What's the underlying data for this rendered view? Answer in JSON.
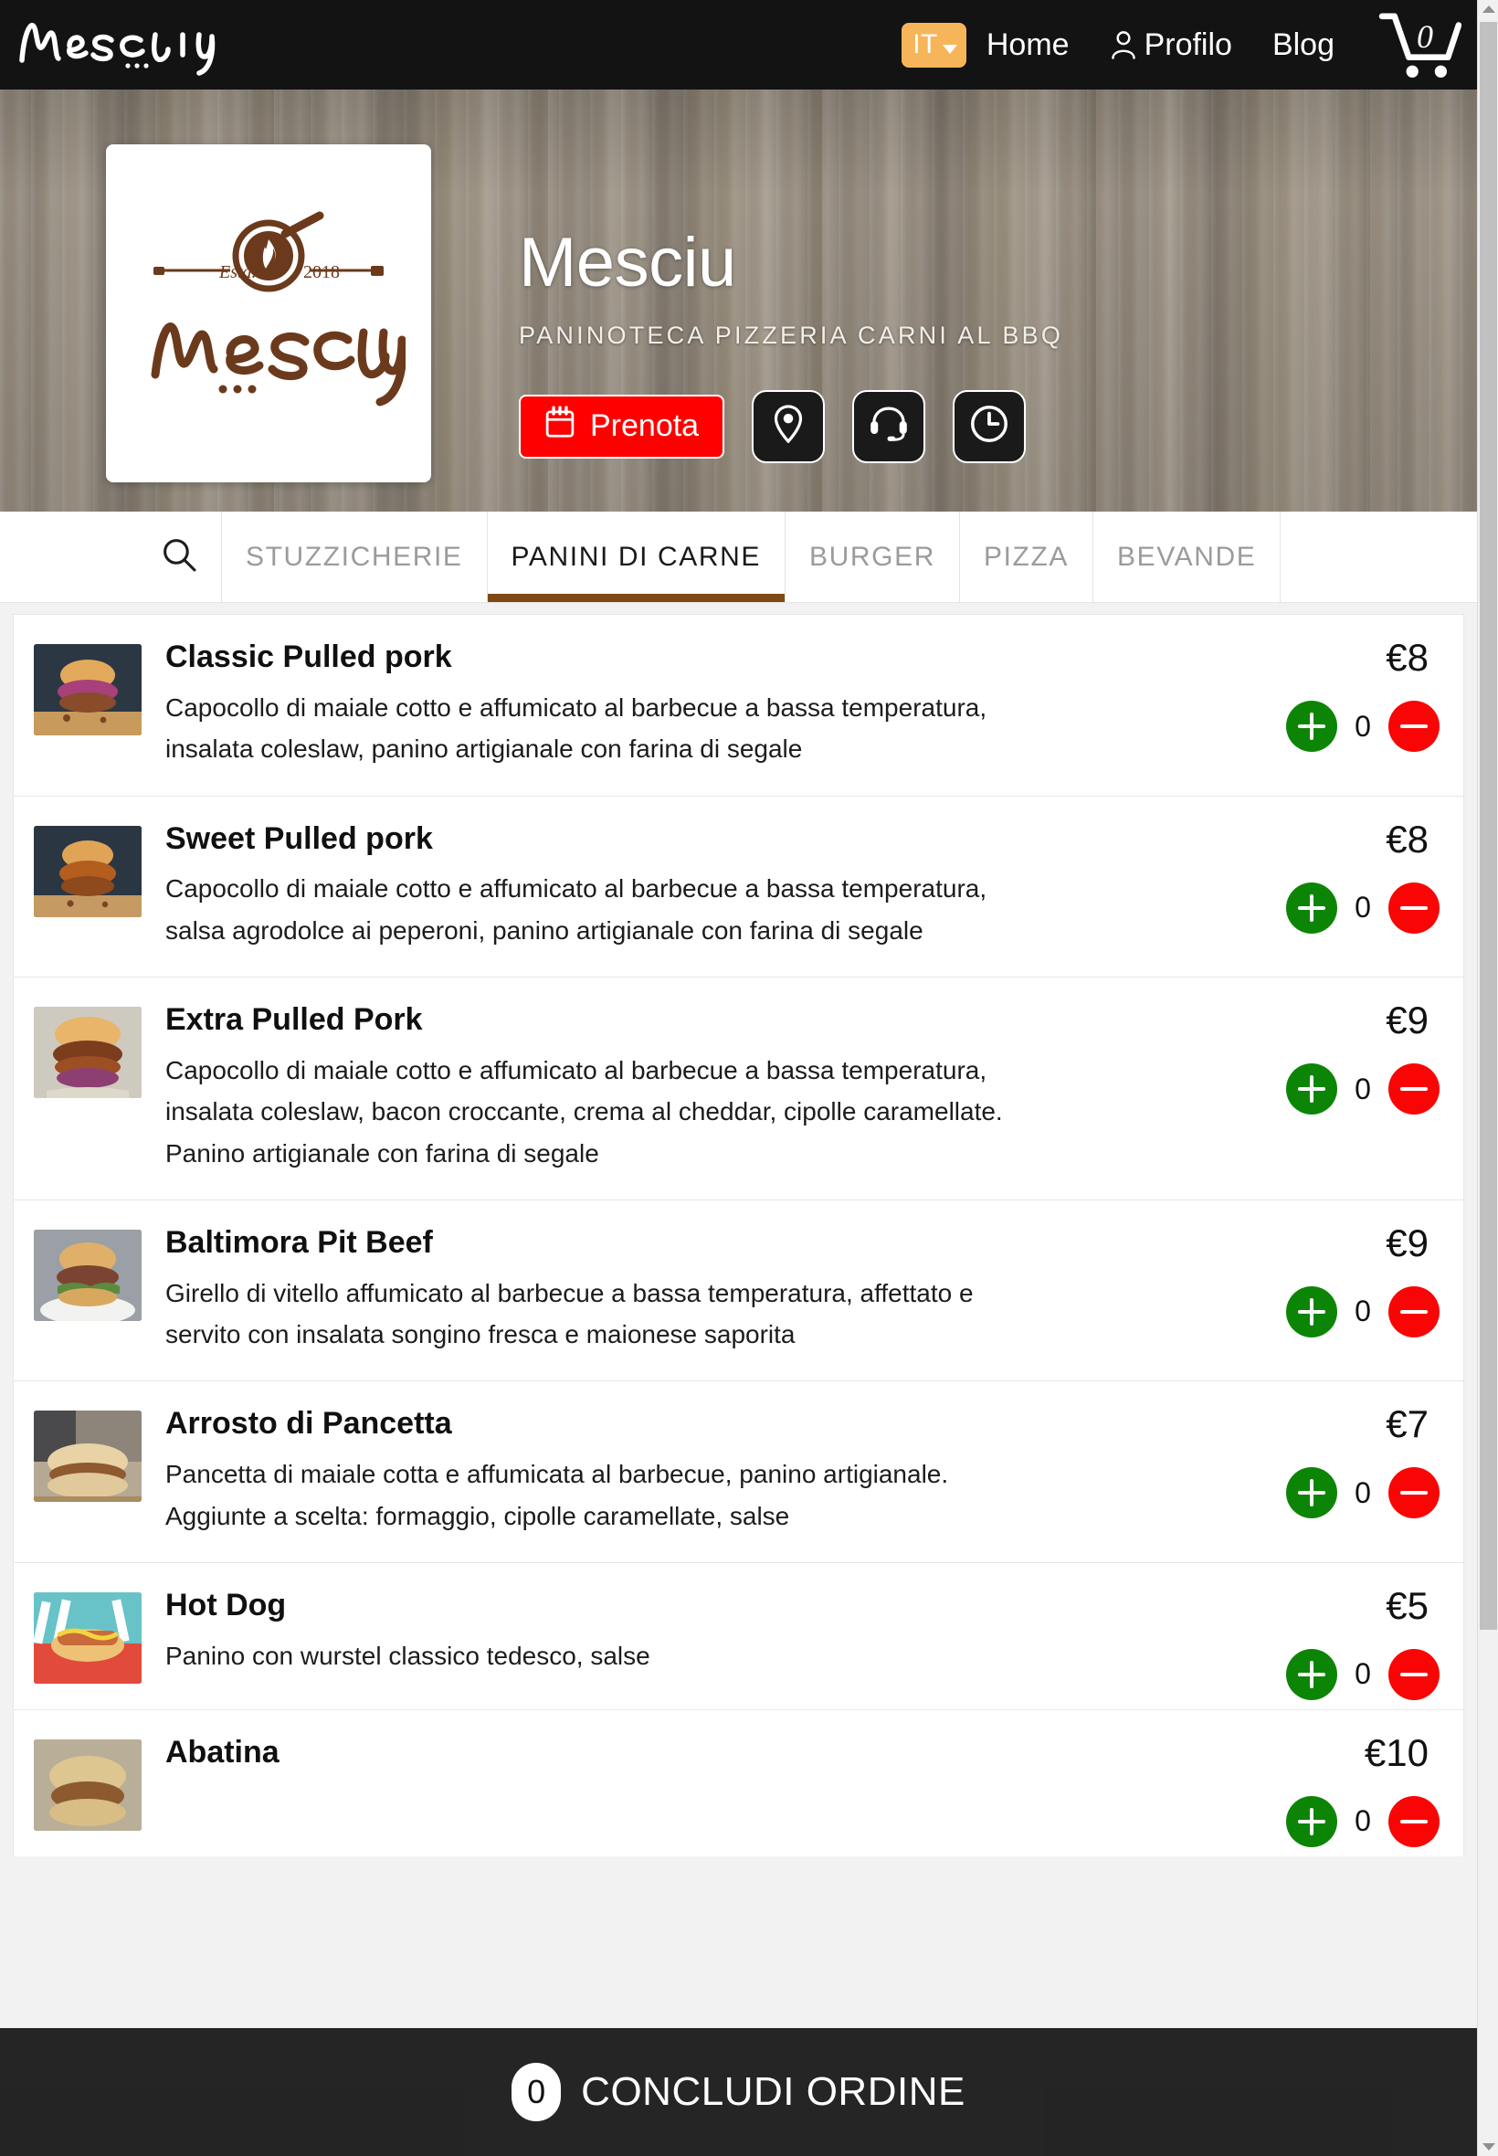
{
  "topnav": {
    "brand": "Mesciu",
    "lang": "IT",
    "links": [
      {
        "label": "Home",
        "icon": ""
      },
      {
        "label": "Profilo",
        "icon": "user-icon"
      },
      {
        "label": "Blog",
        "icon": ""
      }
    ],
    "cart_count": "0"
  },
  "hero": {
    "title": "Mesciu",
    "subtitle": "PANINOTECA PIZZERIA CARNI AL BBQ",
    "logo_text": "Mesciu",
    "logo_estd": "Estd.",
    "logo_year": "2018",
    "actions": {
      "prenota_label": "Prenota",
      "prenota_icon": "calendar-icon",
      "location_icon": "map-pin-icon",
      "support_icon": "headset-icon",
      "hours_icon": "clock-icon"
    }
  },
  "tabs": {
    "search_icon": "search-icon",
    "items": [
      {
        "label": "STUZZICHERIE",
        "active": false
      },
      {
        "label": "PANINI DI CARNE",
        "active": true
      },
      {
        "label": "BURGER",
        "active": false
      },
      {
        "label": "PIZZA",
        "active": false
      },
      {
        "label": "BEVANDE",
        "active": false
      }
    ]
  },
  "menu": {
    "items": [
      {
        "name": "Classic Pulled pork",
        "desc": "Capocollo di maiale cotto e affumicato al barbecue a bassa temperatura, insalata coleslaw, panino artigianale con farina di segale",
        "price": "€8",
        "qty": "0",
        "thumb": "pulled-pork-sandwich"
      },
      {
        "name": "Sweet Pulled pork",
        "desc": "Capocollo di maiale cotto e affumicato al barbecue a bassa temperatura, salsa agrodolce ai peperoni, panino artigianale con farina di segale",
        "price": "€8",
        "qty": "0",
        "thumb": "sweet-pulled-pork-sandwich"
      },
      {
        "name": "Extra Pulled Pork",
        "desc": "Capocollo di maiale cotto e affumicato al barbecue a bassa temperatura, insalata coleslaw, bacon croccante, crema al cheddar, cipolle caramellate. Panino artigianale con farina di segale",
        "price": "€9",
        "qty": "0",
        "thumb": "extra-pulled-pork-sandwich"
      },
      {
        "name": "Baltimora Pit Beef",
        "desc": "Girello di vitello affumicato al barbecue a bassa temperatura, affettato e servito con insalata songino fresca e maionese saporita",
        "price": "€9",
        "qty": "0",
        "thumb": "pit-beef-sandwich"
      },
      {
        "name": "Arrosto di Pancetta",
        "desc": "Pancetta di maiale cotta e affumicata al barbecue, panino artigianale. Aggiunte a scelta: formaggio, cipolle caramellate, salse",
        "price": "€7",
        "qty": "0",
        "thumb": "pancetta-sandwich"
      },
      {
        "name": "Hot Dog",
        "desc": "Panino con wurstel classico tedesco, salse",
        "price": "€5",
        "qty": "0",
        "thumb": "hot-dog-basket"
      },
      {
        "name": "Abatina",
        "desc": "",
        "price": "€10",
        "qty": "0",
        "thumb": "abatina-sandwich"
      }
    ],
    "qty_plus_icon": "plus-icon",
    "qty_minus_icon": "minus-icon"
  },
  "bottom_bar": {
    "count": "0",
    "label": "CONCLUDI ORDINE"
  },
  "colors": {
    "nav_background": "#131313",
    "accent_orange": "#f7b55a",
    "prenota_red": "#ff0000",
    "active_tab_underline": "#7d4a16",
    "qty_plus_green": "#0c8506",
    "qty_minus_red": "#fa0505"
  }
}
